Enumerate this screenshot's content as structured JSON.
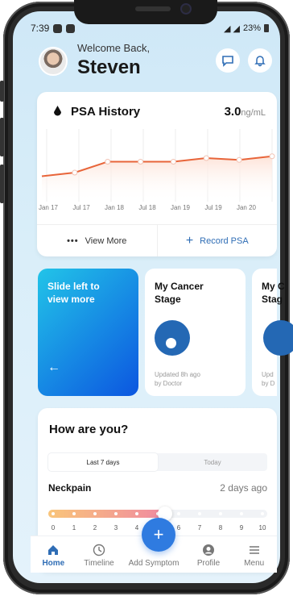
{
  "status_bar": {
    "time": "7:39",
    "battery": "23%"
  },
  "header": {
    "welcome": "Welcome Back,",
    "name": "Steven"
  },
  "psa": {
    "title": "PSA History",
    "current_value": "3.0",
    "unit": "ng/mL",
    "view_more": "View More",
    "record": "Record PSA"
  },
  "chart_data": {
    "type": "line",
    "x": [
      "Jan 17",
      "Jul 17",
      "Jan 18",
      "Jul 18",
      "Jan 19",
      "Jul 19",
      "Jan 20"
    ],
    "series": [
      {
        "values": [
          2.2,
          2.3,
          2.6,
          2.6,
          2.6,
          2.7,
          2.65,
          2.75
        ]
      }
    ],
    "color": "#e8653a"
  },
  "cards": {
    "slide": {
      "text": "Slide left to view more"
    },
    "stage1": {
      "title": "My Cancer Stage",
      "updated": "Updated 8h ago",
      "by": "by Doctor"
    },
    "stage2": {
      "title": "My C",
      "title2": "Stag",
      "updated": "Upd",
      "by": "by D"
    }
  },
  "how": {
    "title": "How are you?",
    "tabs": [
      "Last 7 days",
      "Today"
    ],
    "symptom": "Neckpain",
    "when": "2 days ago",
    "scale": [
      "0",
      "1",
      "2",
      "3",
      "4",
      "5",
      "6",
      "7",
      "8",
      "9",
      "10"
    ],
    "level": 6
  },
  "nav": {
    "items": [
      {
        "label": "Home",
        "icon": "home-icon"
      },
      {
        "label": "Timeline",
        "icon": "clock-icon"
      },
      {
        "label": "Add Symptom",
        "icon": "plus-icon"
      },
      {
        "label": "Profile",
        "icon": "user-icon"
      },
      {
        "label": "Menu",
        "icon": "menu-icon"
      }
    ]
  },
  "colors": {
    "accent": "#2f6db5",
    "chart": "#e8653a"
  }
}
